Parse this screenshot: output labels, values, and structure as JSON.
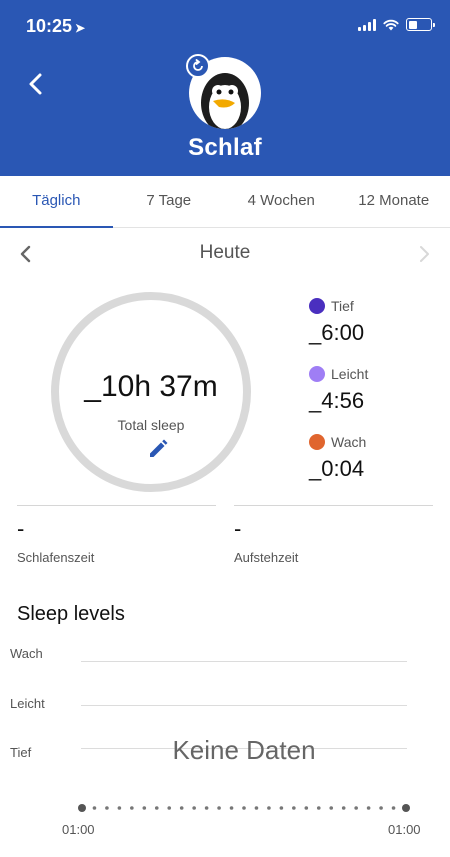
{
  "status_bar": {
    "time": "10:25"
  },
  "header": {
    "title": "Schlaf",
    "colors": {
      "background": "#2a57b4"
    }
  },
  "tabs": [
    {
      "label": "Täglich",
      "active": true
    },
    {
      "label": "7 Tage",
      "active": false
    },
    {
      "label": "4 Wochen",
      "active": false
    },
    {
      "label": "12 Monate",
      "active": false
    }
  ],
  "day_nav": {
    "label": "Heute"
  },
  "summary": {
    "total": "_10h 37m",
    "total_label": "Total sleep"
  },
  "legend": [
    {
      "label": "Tief",
      "value": "_6:00",
      "color": "#4a2fbf"
    },
    {
      "label": "Leicht",
      "value": "_4:56",
      "color": "#9f7ef5"
    },
    {
      "label": "Wach",
      "value": "_0:04",
      "color": "#e0652e"
    }
  ],
  "bedtime": {
    "value": "-",
    "label": "Schlafenszeit"
  },
  "wakeup": {
    "value": "-",
    "label": "Aufstehzeit"
  },
  "sleep_levels": {
    "title": "Sleep levels",
    "levels": [
      "Wach",
      "Leicht",
      "Tief"
    ],
    "empty_text": "Keine Daten",
    "axis_start": "01:00",
    "axis_end": "01:00"
  }
}
